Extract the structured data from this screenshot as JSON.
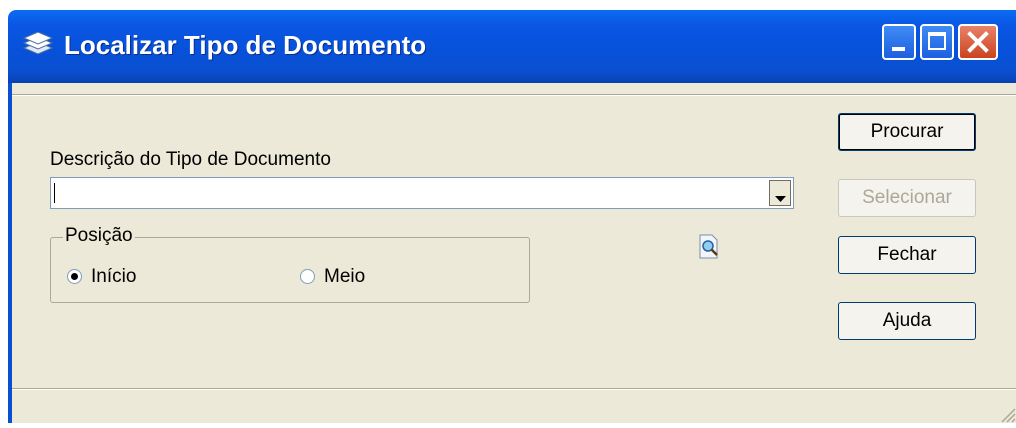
{
  "window": {
    "title": "Localizar Tipo de Documento",
    "icon": "stacked-documents-icon",
    "controls": [
      "minimize-icon",
      "maximize-icon",
      "close-icon"
    ]
  },
  "form": {
    "description_label": "Descrição do Tipo de Documento",
    "description_value": "",
    "position_group": {
      "legend": "Posição",
      "options": [
        {
          "label": "Início",
          "selected": true
        },
        {
          "label": "Meio",
          "selected": false
        }
      ]
    }
  },
  "buttons": {
    "search": "Procurar",
    "select": "Selecionar",
    "close": "Fechar",
    "help": "Ajuda"
  },
  "colors": {
    "titlebar": "#0a57e4",
    "dialog_bg": "#ece9d8",
    "close_button": "#c9431f"
  }
}
